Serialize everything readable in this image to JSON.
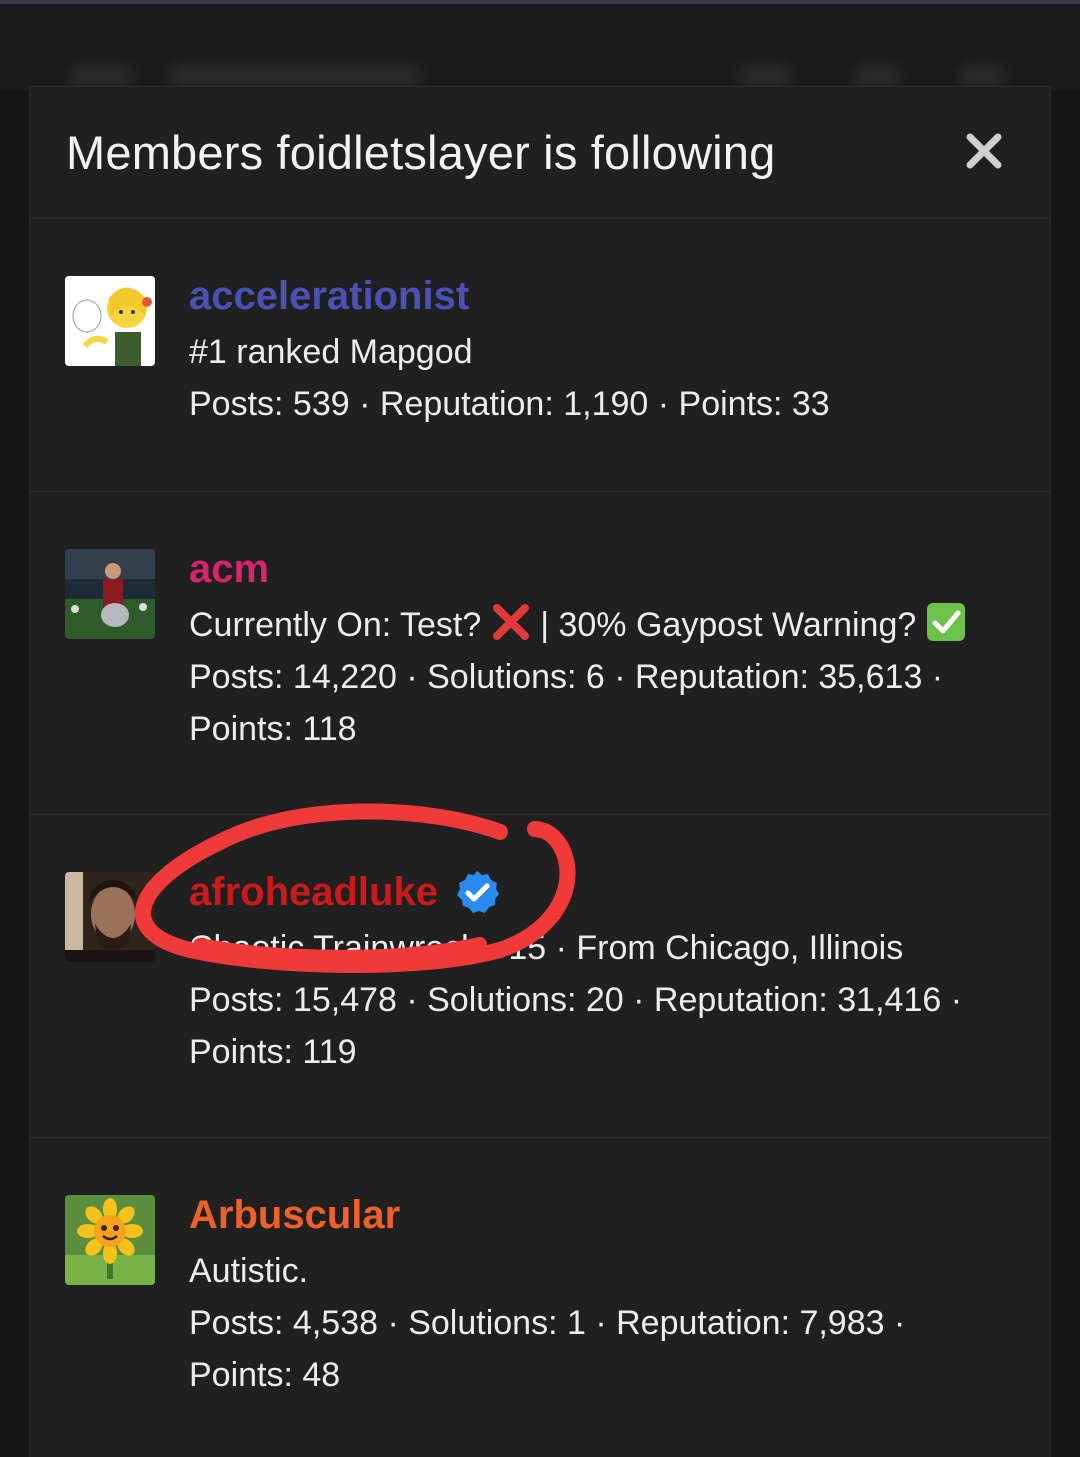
{
  "modal": {
    "title": "Members foidletslayer is following",
    "close_icon": "close-icon"
  },
  "members": [
    {
      "username": "accelerationist",
      "username_color": "#4a52b8",
      "custom_title": "#1 ranked Mapgod",
      "stats_line1": "Posts: 539 · Reputation: 1,190 · Points: 33",
      "stats_line2": ""
    },
    {
      "username": "acm",
      "username_color": "#d8246a",
      "custom_title_prefix": "Currently On: Test?",
      "custom_title_mid": "| 30% Gaypost Warning?",
      "stats_line1": "Posts: 14,220 · Solutions: 6 · Reputation: 35,613 ·",
      "stats_line2": "Points: 118"
    },
    {
      "username": "afroheadluke",
      "username_color": "#cc1a1a",
      "verified_icon": "verified-badge-icon",
      "custom_title": "Chaotic Trainwreck · 15 · From Chicago, Illinois",
      "stats_line1": "Posts: 15,478 · Solutions: 20 · Reputation: 31,416 ·",
      "stats_line2": "Points: 119"
    },
    {
      "username": "Arbuscular",
      "username_color": "#f0602a",
      "custom_title": "Autistic.",
      "stats_line1": "Posts: 4,538 · Solutions: 1 · Reputation: 7,983 ·",
      "stats_line2": "Points: 48"
    }
  ],
  "annotation": {
    "color": "#f03a3a"
  }
}
